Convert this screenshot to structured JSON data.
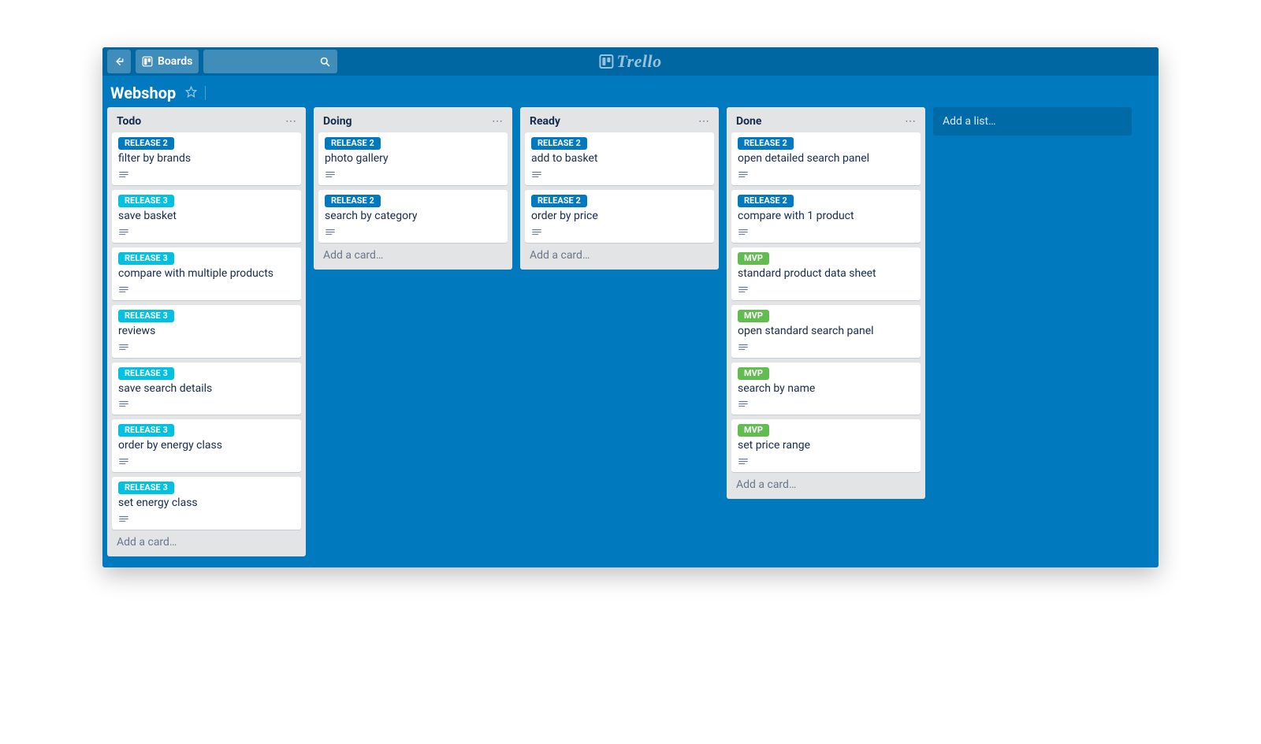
{
  "topbar": {
    "boards_label": "Boards",
    "logo_text": "Trello"
  },
  "board": {
    "title": "Webshop"
  },
  "label_colors": {
    "RELEASE 2": "blue",
    "RELEASE 3": "cyan",
    "MVP": "green"
  },
  "lists": [
    {
      "title": "Todo",
      "cards": [
        {
          "label": "RELEASE 2",
          "title": "filter by brands",
          "has_description": true
        },
        {
          "label": "RELEASE 3",
          "title": "save basket",
          "has_description": true
        },
        {
          "label": "RELEASE 3",
          "title": "compare with multiple products",
          "has_description": true
        },
        {
          "label": "RELEASE 3",
          "title": "reviews",
          "has_description": true
        },
        {
          "label": "RELEASE 3",
          "title": "save search details",
          "has_description": true
        },
        {
          "label": "RELEASE 3",
          "title": "order by energy class",
          "has_description": true
        },
        {
          "label": "RELEASE 3",
          "title": "set energy class",
          "has_description": true
        }
      ]
    },
    {
      "title": "Doing",
      "cards": [
        {
          "label": "RELEASE 2",
          "title": "photo gallery",
          "has_description": true
        },
        {
          "label": "RELEASE 2",
          "title": "search by category",
          "has_description": true
        }
      ]
    },
    {
      "title": "Ready",
      "cards": [
        {
          "label": "RELEASE 2",
          "title": "add to basket",
          "has_description": true
        },
        {
          "label": "RELEASE 2",
          "title": "order by price",
          "has_description": true
        }
      ]
    },
    {
      "title": "Done",
      "cards": [
        {
          "label": "RELEASE 2",
          "title": "open detailed search panel",
          "has_description": true
        },
        {
          "label": "RELEASE 2",
          "title": "compare with 1 product",
          "has_description": true
        },
        {
          "label": "MVP",
          "title": "standard product data sheet",
          "has_description": true
        },
        {
          "label": "MVP",
          "title": "open standard search panel",
          "has_description": true
        },
        {
          "label": "MVP",
          "title": "search by name",
          "has_description": true
        },
        {
          "label": "MVP",
          "title": "set price range",
          "has_description": true
        }
      ]
    }
  ],
  "strings": {
    "add_card": "Add a card…",
    "add_list": "Add a list…",
    "list_menu": "⋯"
  }
}
